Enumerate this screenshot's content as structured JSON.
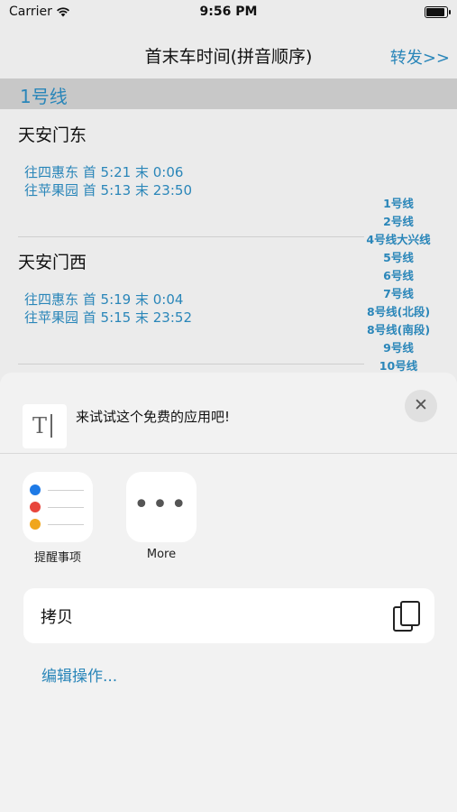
{
  "status_bar": {
    "carrier": "Carrier",
    "time": "9:56 PM"
  },
  "nav": {
    "title": "首末车时间(拼音顺序)",
    "forward": "转发>>"
  },
  "section": {
    "title": "1号线"
  },
  "stations": [
    {
      "name": "天安门东",
      "times": [
        "往四惠东 首 5:21 末  0:06",
        "往苹果园 首 5:13 末 23:50"
      ]
    },
    {
      "name": "天安门西",
      "times": [
        "往四惠东 首 5:19 末  0:04",
        "往苹果园 首 5:15 末 23:52"
      ]
    }
  ],
  "index": [
    "1号线",
    "2号线",
    "4号线大兴线",
    "5号线",
    "6号线",
    "7号线",
    "8号线(北段)",
    "8号线(南段)",
    "9号线",
    "10号线"
  ],
  "sheet": {
    "thumb_text": "T",
    "message": "来试试这个免费的应用吧!",
    "close": "✕",
    "apps": [
      {
        "label": "提醒事项",
        "icon": "reminders-icon"
      },
      {
        "label": "More",
        "icon": "more-icon",
        "glyph": "•••"
      }
    ],
    "copy_label": "拷贝",
    "edit_actions": "编辑操作..."
  },
  "colors": {
    "accent": "#2a86b9",
    "sheet_bg": "#f2f2f2",
    "reminder_dots": [
      "#1e7ae6",
      "#e8453c",
      "#f0a61c"
    ]
  }
}
